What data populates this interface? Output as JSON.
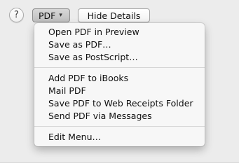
{
  "toolbar": {
    "help_symbol": "?",
    "pdf_label": "PDF",
    "pdf_chevron": "▾",
    "hide_details_label": "Hide Details"
  },
  "pdf_menu": {
    "group1": [
      "Open PDF in Preview",
      "Save as PDF…",
      "Save as PostScript…"
    ],
    "group2": [
      "Add PDF to iBooks",
      "Mail PDF",
      "Save PDF to Web Receipts Folder",
      "Send PDF via Messages"
    ],
    "group3": [
      "Edit Menu…"
    ]
  },
  "icons": {
    "help": "help-icon",
    "dropdown": "chevron-down-icon"
  }
}
